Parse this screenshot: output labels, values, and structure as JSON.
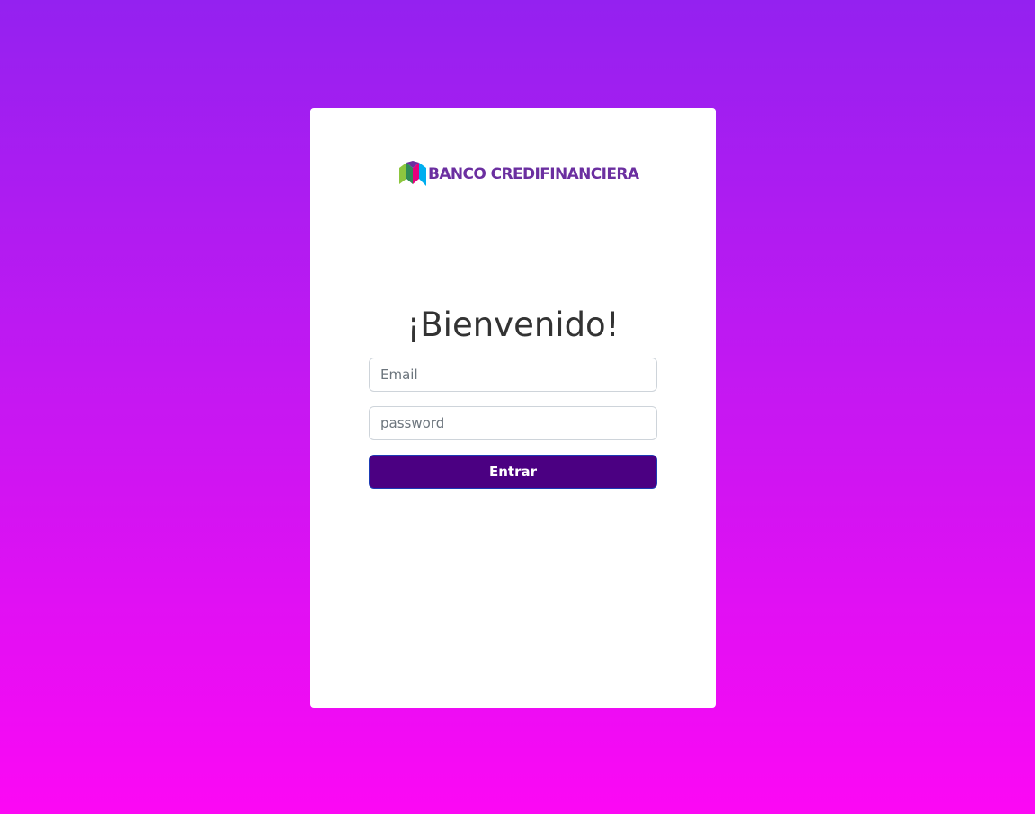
{
  "brand": {
    "logo_icon": "banco-credifinanciera-logo-icon",
    "name": "Banco Credifinanciera",
    "text_color": "#6b2fa0"
  },
  "login": {
    "title": "¡Bienvenido!",
    "email_placeholder": "Email",
    "email_value": "",
    "password_placeholder": "password",
    "password_value": "",
    "submit_label": "Entrar"
  },
  "colors": {
    "background_top": "#9421f0",
    "background_bottom": "#fc08f4",
    "button": "#4b0082",
    "button_border": "#1d3bb5",
    "card": "#ffffff"
  }
}
